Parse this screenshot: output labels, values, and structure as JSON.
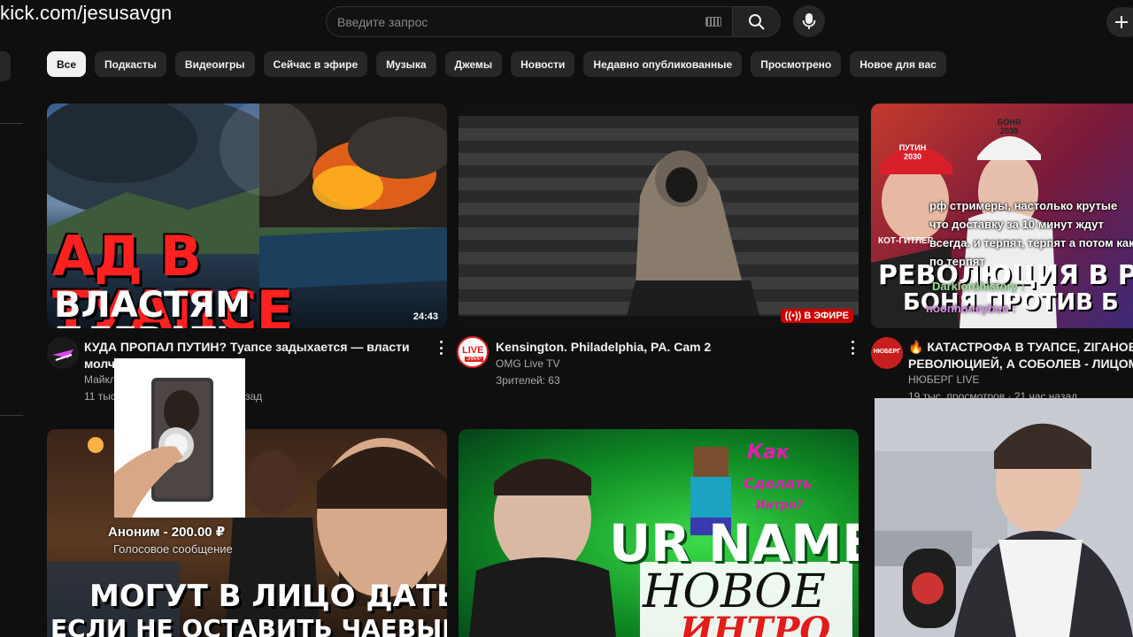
{
  "overlay": {
    "stream_url": "kick.com/jesusavgn"
  },
  "header": {
    "search_placeholder": "Введите запрос",
    "icons": [
      "keyboard-icon",
      "search-icon",
      "mic-icon",
      "plus-icon"
    ]
  },
  "chips": [
    {
      "label": "Все",
      "active": true
    },
    {
      "label": "Подкасты"
    },
    {
      "label": "Видеоигры"
    },
    {
      "label": "Сейчас в эфире"
    },
    {
      "label": "Музыка"
    },
    {
      "label": "Джемы"
    },
    {
      "label": "Новости"
    },
    {
      "label": "Недавно опубликованные"
    },
    {
      "label": "Просмотрено"
    },
    {
      "label": "Новое для вас"
    }
  ],
  "videos": [
    {
      "thumb_line1": "АД В ТУАПСЕ",
      "thumb_line2": "ВЛАСТЯМ ПЛЕВАТЬ",
      "duration": "24:43",
      "title_line1": "КУДА ПРОПАЛ ПУТИН? Туапсе задыхается — власти",
      "title_line2": "молч",
      "channel": "Майкл",
      "meta_left": "11 тыс",
      "meta_right": "зад"
    },
    {
      "live_badge": "((•)) В ЭФИРЕ",
      "title": "Kensington. Philadelphia, PA. Cam 2",
      "channel": "OMG Live TV",
      "viewers": "Зрителей: 63",
      "avatar_text": "LIVE",
      "avatar_sub": "ЭФИР"
    },
    {
      "thumb_line1": "РЕВОЛЮЦИЯ В Р",
      "thumb_line2": "БОНЯ ПРОТИВ Б",
      "cap1": "ПУТИН 2030",
      "cap2": "БОНЯ 2030",
      "title_line1": "🔥 КАТАСТРОФА В ТУАПСЕ, ZIГАНОВ П",
      "title_line2": "РЕВОЛЮЦИЕЙ, А СОБОЛЕВ - ЛИЦОМ I M",
      "channel": "НЮБЕРГ LIVE",
      "meta": "19 тыс. просмотров · 21 час назад",
      "avatar_text": "НЮБЕРГ",
      "kot_label": "КОТ-ГИТЛЕР"
    },
    {
      "thumb_line1": "МОГУТ В ЛИЦО ДАТЬ,",
      "thumb_line2": "ЕСЛИ НЕ ОСТАВИТЬ ЧАЕВЫЕ?"
    },
    {
      "thumb_big": "UR NAME",
      "thumb_hand": "НОВОЕ",
      "thumb_hand2": "ИНТРО",
      "kak": "Как",
      "sdelat": "Сделать",
      "intro_q": "Интро?"
    }
  ],
  "donation": {
    "name": "Аноним - 200.00 ₽",
    "type": "Голосовое сообщение"
  },
  "chat": {
    "message": "рф стримеры, настолько крутые что доставку за 10 минут ждут всегда. и терпят, терпят а потом как по терпят",
    "user1": "Darklordhistory :",
    "user2": "noonhoneybun :"
  },
  "colors": {
    "background": "#0f0f0f",
    "chip_bg": "#272727",
    "live_red": "#cc0000"
  }
}
